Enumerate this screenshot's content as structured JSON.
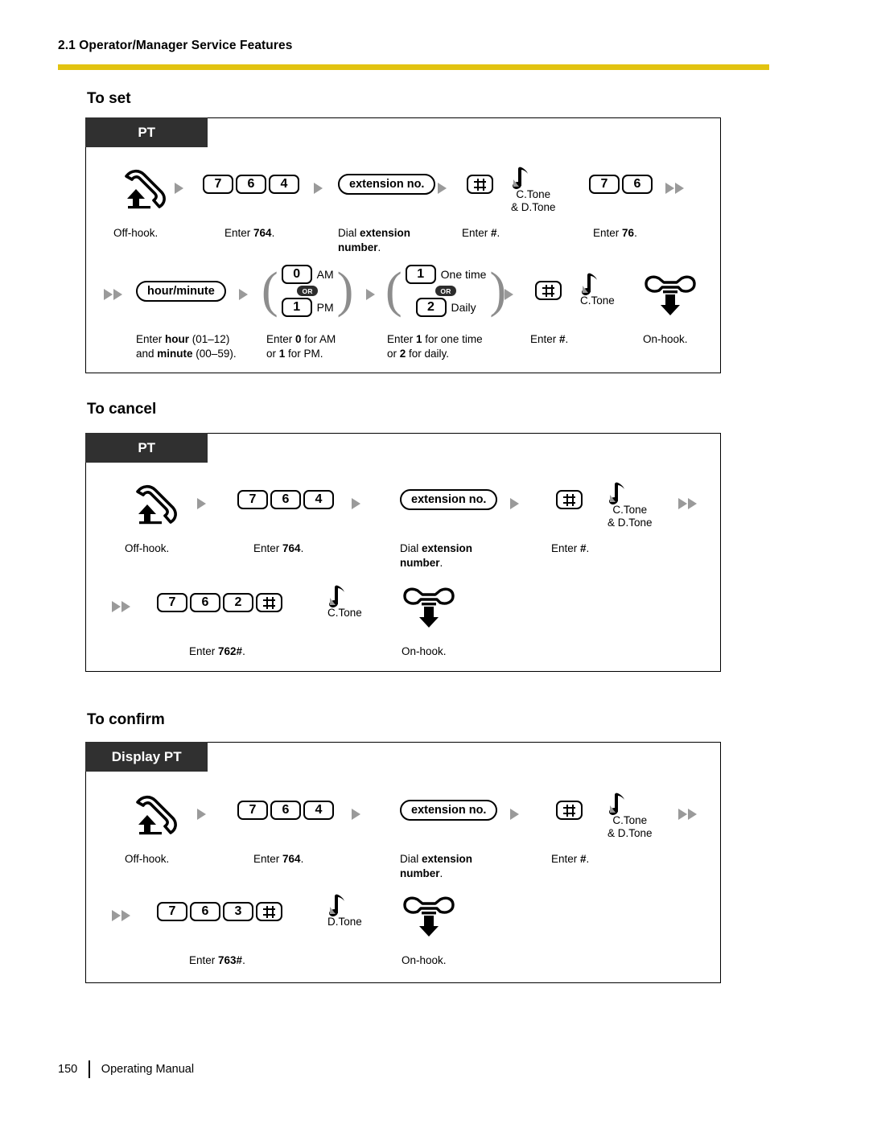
{
  "header": {
    "title": "2.1 Operator/Manager Service Features",
    "rule_color": "#e2c310"
  },
  "footer": {
    "page_number": "150",
    "manual_label": "Operating Manual"
  },
  "sections": [
    {
      "title": "To set",
      "tab_label": "PT",
      "row1": {
        "offhook_caption": "Off-hook.",
        "keys_764": [
          "7",
          "6",
          "4"
        ],
        "caption_764_prefix": "Enter ",
        "caption_764_bold": "764",
        "caption_764_suffix": ".",
        "extension_pill": "extension no.",
        "caption_ext_line1_prefix": "Dial ",
        "caption_ext_line1_bold": "extension",
        "caption_ext_line2_bold": "number",
        "caption_ext_line2_suffix": ".",
        "hash_caption_prefix": "Enter ",
        "hash_caption_bold": "#",
        "hash_caption_suffix": ".",
        "tone_line1": "C.Tone",
        "tone_line2": "& D.Tone",
        "keys_76": [
          "7",
          "6"
        ],
        "caption_76_prefix": "Enter ",
        "caption_76_bold": "76",
        "caption_76_suffix": "."
      },
      "row2": {
        "hourminute_pill": "hour/minute",
        "caption_hm_line1_prefix": "Enter ",
        "caption_hm_line1_bold": "hour",
        "caption_hm_line1_suffix": " (01–12)",
        "caption_hm_line2_prefix": "and ",
        "caption_hm_line2_bold": "minute",
        "caption_hm_line2_suffix": " (00–59).",
        "ampm": {
          "top_key": "0",
          "top_label": "AM",
          "or_badge": "OR",
          "bottom_key": "1",
          "bottom_label": "PM"
        },
        "caption_ampm_line1_prefix": "Enter ",
        "caption_ampm_line1_bold": "0",
        "caption_ampm_line1_suffix": " for AM",
        "caption_ampm_line2_prefix": "or ",
        "caption_ampm_line2_bold": "1",
        "caption_ampm_line2_suffix": " for PM.",
        "freq": {
          "top_key": "1",
          "top_label": "One time",
          "or_badge": "OR",
          "bottom_key": "2",
          "bottom_label": "Daily"
        },
        "caption_freq_line1_prefix": "Enter ",
        "caption_freq_line1_bold": "1",
        "caption_freq_line1_suffix": " for one time",
        "caption_freq_line2_prefix": "or ",
        "caption_freq_line2_bold": "2",
        "caption_freq_line2_suffix": " for daily.",
        "hash_caption_prefix": "Enter ",
        "hash_caption_bold": "#",
        "hash_caption_suffix": ".",
        "tone_line1": "C.Tone",
        "onhook_caption": "On-hook."
      }
    },
    {
      "title": "To cancel",
      "tab_label": "PT",
      "row1": {
        "offhook_caption": "Off-hook.",
        "keys_764": [
          "7",
          "6",
          "4"
        ],
        "caption_764_prefix": "Enter ",
        "caption_764_bold": "764",
        "caption_764_suffix": ".",
        "extension_pill": "extension no.",
        "caption_ext_line1_prefix": "Dial ",
        "caption_ext_line1_bold": "extension",
        "caption_ext_line2_bold": "number",
        "caption_ext_line2_suffix": ".",
        "hash_caption_prefix": "Enter ",
        "hash_caption_bold": "#",
        "hash_caption_suffix": ".",
        "tone_line1": "C.Tone",
        "tone_line2": "& D.Tone"
      },
      "row2": {
        "keys_762": [
          "7",
          "6",
          "2"
        ],
        "caption_762_prefix": "Enter ",
        "caption_762_bold": "762#",
        "caption_762_suffix": ".",
        "tone_line1": "C.Tone",
        "onhook_caption": "On-hook."
      }
    },
    {
      "title": "To confirm",
      "tab_label": "Display PT",
      "row1": {
        "offhook_caption": "Off-hook.",
        "keys_764": [
          "7",
          "6",
          "4"
        ],
        "caption_764_prefix": "Enter ",
        "caption_764_bold": "764",
        "caption_764_suffix": ".",
        "extension_pill": "extension no.",
        "caption_ext_line1_prefix": "Dial ",
        "caption_ext_line1_bold": "extension",
        "caption_ext_line2_bold": "number",
        "caption_ext_line2_suffix": ".",
        "hash_caption_prefix": "Enter ",
        "hash_caption_bold": "#",
        "hash_caption_suffix": ".",
        "tone_line1": "C.Tone",
        "tone_line2": "& D.Tone"
      },
      "row2": {
        "keys_763": [
          "7",
          "6",
          "3"
        ],
        "caption_763_prefix": "Enter ",
        "caption_763_bold": "763#",
        "caption_763_suffix": ".",
        "tone_line1": "D.Tone",
        "onhook_caption": "On-hook."
      }
    }
  ]
}
